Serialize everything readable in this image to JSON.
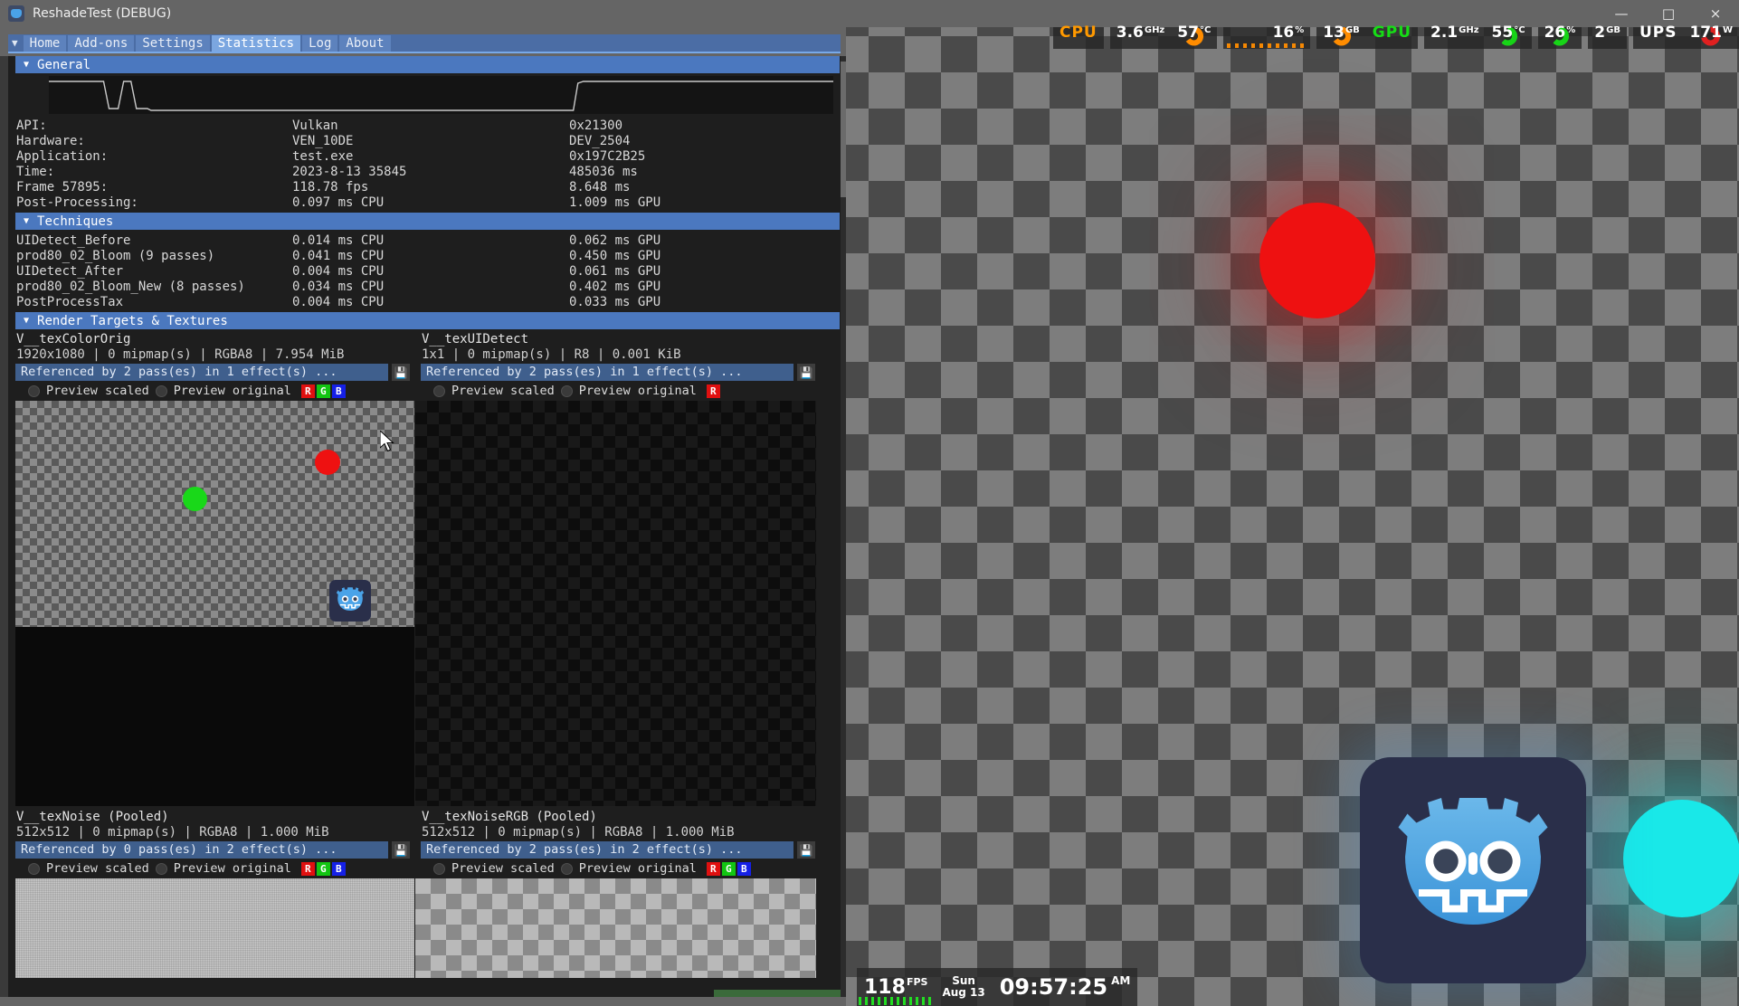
{
  "window": {
    "title": "ReshadeTest (DEBUG)",
    "icon": "godot-app-icon",
    "minimize": "—",
    "maximize": "□",
    "close": "×"
  },
  "tabs": {
    "caret": "▼",
    "items": [
      {
        "label": "Home",
        "active": false
      },
      {
        "label": "Add-ons",
        "active": false
      },
      {
        "label": "Settings",
        "active": false
      },
      {
        "label": "Statistics",
        "active": true
      },
      {
        "label": "Log",
        "active": false
      },
      {
        "label": "About",
        "active": false
      }
    ]
  },
  "sections": {
    "general": {
      "caret": "▼",
      "title": "General",
      "rows": [
        {
          "label": "API:",
          "mid": "Vulkan",
          "right": "0x21300"
        },
        {
          "label": "Hardware:",
          "mid": "VEN_10DE",
          "right": "DEV_2504"
        },
        {
          "label": "Application:",
          "mid": "test.exe",
          "right": "0x197C2B25"
        },
        {
          "label": "Time:",
          "mid": "2023-8-13 35845",
          "right": "485036 ms"
        },
        {
          "label": "Frame 57895:",
          "mid": "118.78 fps",
          "right": "8.648 ms"
        },
        {
          "label": "Post-Processing:",
          "mid": "0.097 ms CPU",
          "right": "1.009 ms GPU"
        }
      ]
    },
    "techniques": {
      "caret": "▼",
      "title": "Techniques",
      "rows": [
        {
          "label": "UIDetect_Before",
          "mid": "0.014 ms CPU",
          "right": "0.062 ms GPU"
        },
        {
          "label": "prod80_02_Bloom (9 passes)",
          "mid": "0.041 ms CPU",
          "right": "0.450 ms GPU"
        },
        {
          "label": "UIDetect_After",
          "mid": "0.004 ms CPU",
          "right": "0.061 ms GPU"
        },
        {
          "label": "prod80_02_Bloom_New (8 passes)",
          "mid": "0.034 ms CPU",
          "right": "0.402 ms GPU"
        },
        {
          "label": "PostProcessTax",
          "mid": "0.004 ms CPU",
          "right": "0.033 ms GPU"
        }
      ]
    },
    "render_targets": {
      "caret": "▼",
      "title": "Render Targets & Textures"
    }
  },
  "textures": [
    {
      "name": "V__texColorOrig",
      "meta": "1920x1080 | 0 mipmap(s) | RGBA8 | 7.954 MiB",
      "reference": "Referenced by 2 pass(es) in 1 effect(s) ...",
      "save_icon": "save-icon",
      "preview_scaled": "Preview scaled",
      "preview_original": "Preview original",
      "channels": [
        "R",
        "G",
        "B"
      ]
    },
    {
      "name": "V__texUIDetect",
      "meta": "1x1 | 0 mipmap(s) | R8 | 0.001 KiB",
      "reference": "Referenced by 2 pass(es) in 1 effect(s) ...",
      "save_icon": "save-icon",
      "preview_scaled": "Preview scaled",
      "preview_original": "Preview original",
      "channels": [
        "R"
      ]
    },
    {
      "name": "V__texNoise (Pooled)",
      "meta": "512x512 | 0 mipmap(s) | RGBA8 | 1.000 MiB",
      "reference": "Referenced by 0 pass(es) in 2 effect(s) ...",
      "save_icon": "save-icon",
      "preview_scaled": "Preview scaled",
      "preview_original": "Preview original",
      "channels": [
        "R",
        "G",
        "B"
      ]
    },
    {
      "name": "V__texNoiseRGB (Pooled)",
      "meta": "512x512 | 0 mipmap(s) | RGBA8 | 1.000 MiB",
      "reference": "Referenced by 2 pass(es) in 2 effect(s) ...",
      "save_icon": "save-icon",
      "preview_scaled": "Preview scaled",
      "preview_original": "Preview original",
      "channels": [
        "R",
        "G",
        "B"
      ]
    }
  ],
  "hw_overlay": {
    "cpu_label": "CPU",
    "cpu_clock": "3.6",
    "cpu_clock_unit": "GHz",
    "cpu_temp": "57",
    "cpu_temp_unit": "°C",
    "cpu_load": "16",
    "cpu_load_unit": "%",
    "cpu_mem": "13",
    "cpu_mem_unit": "GB",
    "gpu_label": "GPU",
    "gpu_clock": "2.1",
    "gpu_clock_unit": "GHz",
    "gpu_temp": "55",
    "gpu_temp_unit": "°C",
    "gpu_load": "26",
    "gpu_load_unit": "%",
    "gpu_mem": "2",
    "gpu_mem_unit": "GB",
    "ups_label": "UPS",
    "ups_power": "171",
    "ups_power_unit": "W"
  },
  "fps_overlay": {
    "fps": "118",
    "fps_unit": "FPS",
    "day": "Sun",
    "date": "Aug 13",
    "time": "09:57:25",
    "meridiem": "AM"
  },
  "colors": {
    "accent_blue": "#4b78bf",
    "header_blue": "#4b6da5",
    "cpu_orange": "#ff9900",
    "gpu_green": "#16dd16",
    "red_ball": "#ee1111",
    "green_ball": "#19d819",
    "cyan_ball": "#19e8e8",
    "godot_blue": "#4aa3e8",
    "panel_bg": "#1e1e1e"
  }
}
